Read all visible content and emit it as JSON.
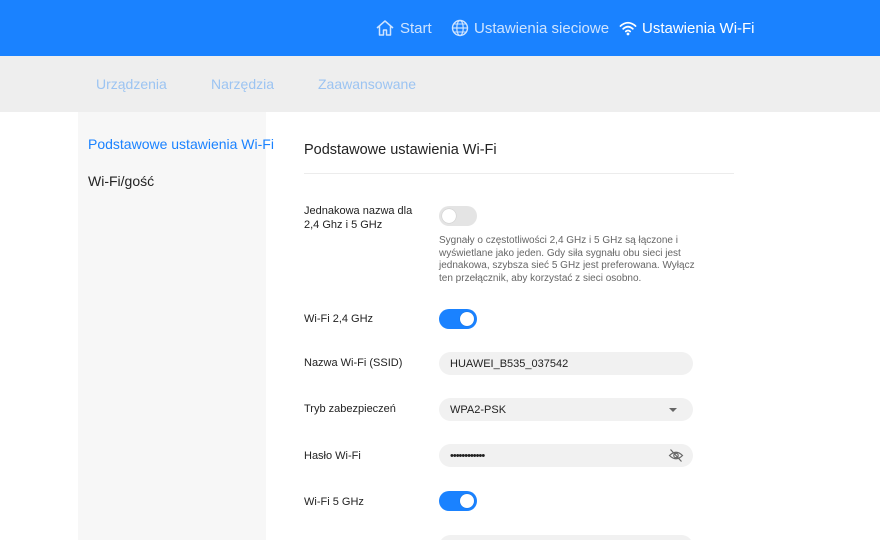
{
  "topnav": {
    "items": [
      {
        "label": "Start",
        "icon": "home-icon"
      },
      {
        "label": "Ustawienia sieciowe",
        "icon": "globe-icon"
      },
      {
        "label": "Ustawienia Wi-Fi",
        "icon": "wifi-icon"
      }
    ],
    "active": "Ustawienia Wi-Fi"
  },
  "subnav": {
    "items": [
      "Urządzenia",
      "Narzędzia",
      "Zaawansowane"
    ]
  },
  "sidebar": {
    "items": [
      {
        "label": "Podstawowe ustawienia Wi-Fi",
        "active": true
      },
      {
        "label": "Wi-Fi/gość",
        "active": false
      }
    ]
  },
  "main": {
    "title": "Podstawowe ustawienia Wi-Fi",
    "same_name": {
      "label": "Jednakowa nazwa dla 2,4 Ghz i 5 GHz",
      "state": "off",
      "description": "Sygnały o częstotliwości 2,4 GHz i 5 GHz są łączone i wyświetlane jako jeden. Gdy siła sygnału obu sieci jest jednakowa, szybsza sieć 5 GHz jest preferowana. Wyłącz ten przełącznik, aby korzystać z sieci osobno."
    },
    "wifi24": {
      "label": "Wi-Fi 2,4 GHz",
      "state": "on"
    },
    "ssid": {
      "label": "Nazwa Wi-Fi (SSID)",
      "value": "HUAWEI_B535_037542"
    },
    "security": {
      "label": "Tryb zabezpieczeń",
      "value": "WPA2-PSK"
    },
    "password": {
      "label": "Hasło Wi-Fi",
      "value": "••••••••••••"
    },
    "wifi5": {
      "label": "Wi-Fi 5 GHz",
      "state": "on"
    }
  },
  "colors": {
    "brand": "#1a82ff",
    "subbar": "#eeeeee",
    "sidebar": "#f7f7f7"
  }
}
